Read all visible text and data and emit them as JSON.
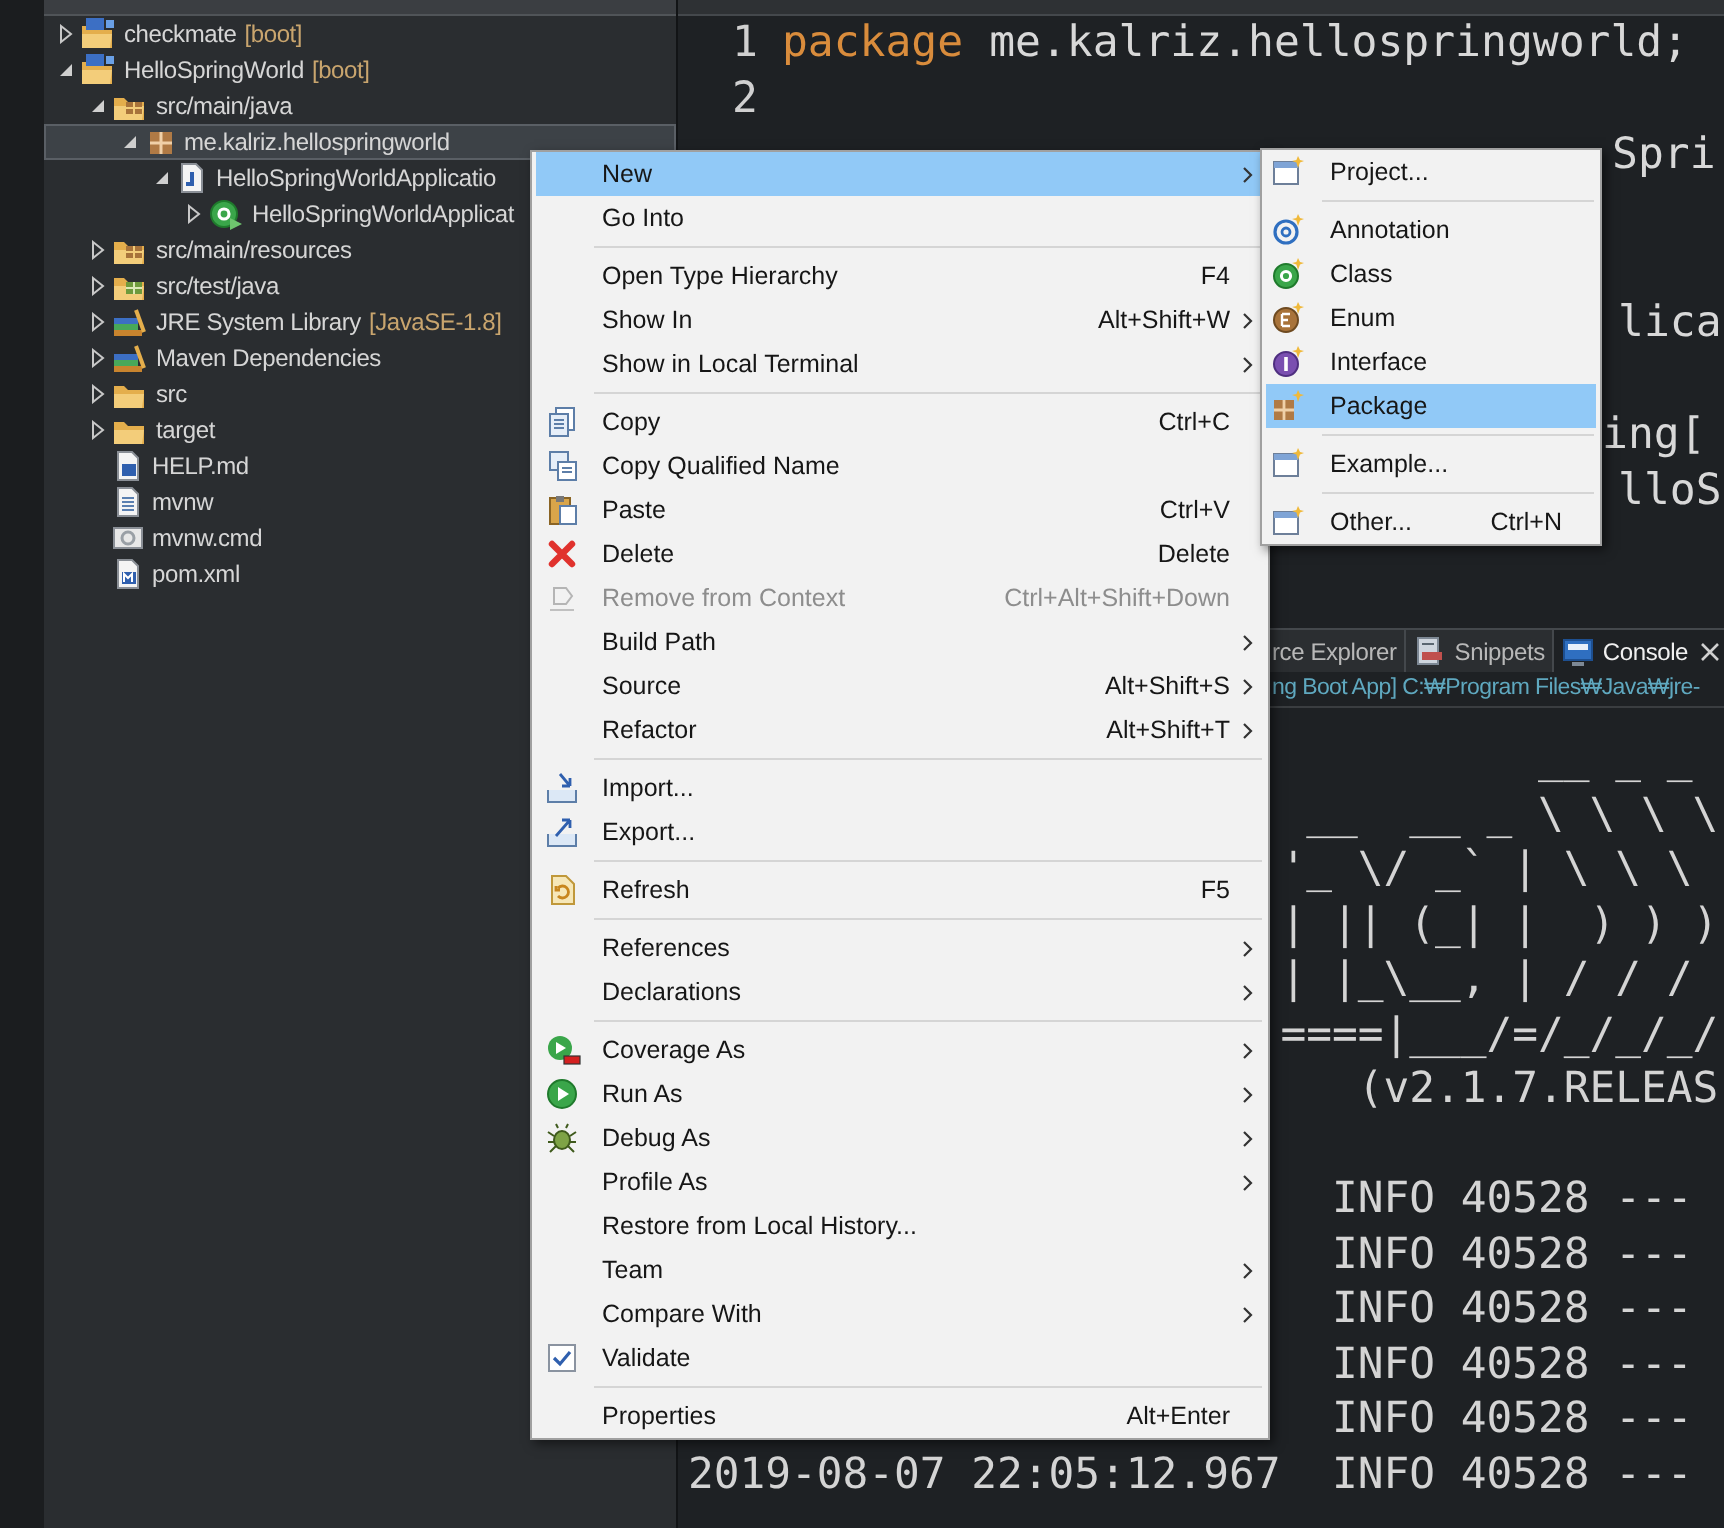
{
  "explorer": {
    "tree": [
      {
        "kind": "project",
        "label": "checkmate",
        "tag": "[boot]",
        "expanded": false,
        "selected": false
      },
      {
        "kind": "project",
        "label": "HelloSpringWorld",
        "tag": "[boot]",
        "expanded": true,
        "selected": false,
        "children": [
          {
            "kind": "srcfolder",
            "label": "src/main/java",
            "expanded": true,
            "selected": false,
            "children": [
              {
                "kind": "package",
                "label": "me.kalriz.hellospringworld",
                "expanded": true,
                "selected": true,
                "children": [
                  {
                    "kind": "javafile",
                    "label": "HelloSpringWorldApplicatio",
                    "expanded": true,
                    "selected": false,
                    "children": [
                      {
                        "kind": "class",
                        "label": "HelloSpringWorldApplicat",
                        "expanded": false,
                        "selected": false
                      }
                    ]
                  }
                ]
              }
            ]
          },
          {
            "kind": "srcfolder",
            "label": "src/main/resources",
            "expanded": false,
            "selected": false
          },
          {
            "kind": "testfolder",
            "label": "src/test/java",
            "expanded": false,
            "selected": false
          },
          {
            "kind": "library",
            "label": "JRE System Library",
            "tag": "[JavaSE-1.8]",
            "expanded": false,
            "selected": false
          },
          {
            "kind": "library",
            "label": "Maven Dependencies",
            "expanded": false,
            "selected": false
          },
          {
            "kind": "folder",
            "label": "src",
            "expanded": false,
            "selected": false
          },
          {
            "kind": "folder",
            "label": "target",
            "expanded": false,
            "selected": false
          },
          {
            "kind": "mdfile",
            "label": "HELP.md",
            "selected": false
          },
          {
            "kind": "textfile",
            "label": "mvnw",
            "selected": false
          },
          {
            "kind": "cmdfile",
            "label": "mvnw.cmd",
            "selected": false
          },
          {
            "kind": "pomfile",
            "label": "pom.xml",
            "selected": false
          }
        ]
      }
    ]
  },
  "editor": {
    "lines": [
      {
        "number": "1",
        "keyword": "package",
        "text": "me.kalriz.hellospringworld;"
      },
      {
        "number": "2"
      }
    ],
    "fragments": [
      "Spri",
      "lica",
      "ing[",
      "lloS"
    ]
  },
  "console": {
    "tabs": [
      {
        "label": "rce Explorer",
        "selected": false
      },
      {
        "label": "Snippets",
        "selected": false
      },
      {
        "label": "Console",
        "selected": true
      }
    ],
    "description": "ng Boot App] C:₩Program Files₩Java₩jre-",
    "lines": [
      "__ _ _",
      "__  __ _ \\ \\ \\ \\",
      "'_ \\/ _` | \\ \\ \\",
      "| || (_| |  ) ) )",
      "| |_\\__, | / / /",
      "====|___/=/_/_/_/",
      "(v2.1.7.RELEAS",
      "INFO 40528 ---",
      "INFO 40528 ---",
      "INFO 40528 ---",
      "INFO 40528 ---",
      "INFO 40528 ---",
      "2019-08-07 22:05:12.967  INFO 40528 ---"
    ]
  },
  "context_menu": {
    "items": [
      {
        "kind": "item",
        "label": "New",
        "has_submenu": true,
        "selected": true,
        "disabled": false
      },
      {
        "kind": "item",
        "label": "Go Into",
        "has_submenu": false,
        "selected": false,
        "disabled": false
      },
      {
        "kind": "separator"
      },
      {
        "kind": "item",
        "label": "Open Type Hierarchy",
        "shortcut": "F4",
        "has_submenu": false,
        "selected": false,
        "disabled": false
      },
      {
        "kind": "item",
        "label": "Show In",
        "shortcut": "Alt+Shift+W",
        "has_submenu": true,
        "selected": false,
        "disabled": false
      },
      {
        "kind": "item",
        "label": "Show in Local Terminal",
        "has_submenu": true,
        "selected": false,
        "disabled": false
      },
      {
        "kind": "separator"
      },
      {
        "kind": "item",
        "label": "Copy",
        "shortcut": "Ctrl+C",
        "has_submenu": false,
        "selected": false,
        "disabled": false
      },
      {
        "kind": "item",
        "label": "Copy Qualified Name",
        "has_submenu": false,
        "selected": false,
        "disabled": false
      },
      {
        "kind": "item",
        "label": "Paste",
        "shortcut": "Ctrl+V",
        "has_submenu": false,
        "selected": false,
        "disabled": false
      },
      {
        "kind": "item",
        "label": "Delete",
        "shortcut": "Delete",
        "has_submenu": false,
        "selected": false,
        "disabled": false
      },
      {
        "kind": "item",
        "label": "Remove from Context",
        "shortcut": "Ctrl+Alt+Shift+Down",
        "has_submenu": false,
        "selected": false,
        "disabled": true
      },
      {
        "kind": "item",
        "label": "Build Path",
        "has_submenu": true,
        "selected": false,
        "disabled": false
      },
      {
        "kind": "item",
        "label": "Source",
        "shortcut": "Alt+Shift+S",
        "has_submenu": true,
        "selected": false,
        "disabled": false
      },
      {
        "kind": "item",
        "label": "Refactor",
        "shortcut": "Alt+Shift+T",
        "has_submenu": true,
        "selected": false,
        "disabled": false
      },
      {
        "kind": "separator"
      },
      {
        "kind": "item",
        "label": "Import...",
        "has_submenu": false,
        "selected": false,
        "disabled": false
      },
      {
        "kind": "item",
        "label": "Export...",
        "has_submenu": false,
        "selected": false,
        "disabled": false
      },
      {
        "kind": "separator"
      },
      {
        "kind": "item",
        "label": "Refresh",
        "shortcut": "F5",
        "has_submenu": false,
        "selected": false,
        "disabled": false
      },
      {
        "kind": "separator"
      },
      {
        "kind": "item",
        "label": "References",
        "has_submenu": true,
        "selected": false,
        "disabled": false
      },
      {
        "kind": "item",
        "label": "Declarations",
        "has_submenu": true,
        "selected": false,
        "disabled": false
      },
      {
        "kind": "separator"
      },
      {
        "kind": "item",
        "label": "Coverage As",
        "has_submenu": true,
        "selected": false,
        "disabled": false
      },
      {
        "kind": "item",
        "label": "Run As",
        "has_submenu": true,
        "selected": false,
        "disabled": false
      },
      {
        "kind": "item",
        "label": "Debug As",
        "has_submenu": true,
        "selected": false,
        "disabled": false
      },
      {
        "kind": "item",
        "label": "Profile As",
        "has_submenu": true,
        "selected": false,
        "disabled": false
      },
      {
        "kind": "item",
        "label": "Restore from Local History...",
        "has_submenu": false,
        "selected": false,
        "disabled": false
      },
      {
        "kind": "item",
        "label": "Team",
        "has_submenu": true,
        "selected": false,
        "disabled": false
      },
      {
        "kind": "item",
        "label": "Compare With",
        "has_submenu": true,
        "selected": false,
        "disabled": false
      },
      {
        "kind": "item",
        "label": "Validate",
        "has_submenu": false,
        "selected": false,
        "disabled": false
      },
      {
        "kind": "separator"
      },
      {
        "kind": "item",
        "label": "Properties",
        "shortcut": "Alt+Enter",
        "has_submenu": false,
        "selected": false,
        "disabled": false
      }
    ]
  },
  "submenu": {
    "items": [
      {
        "kind": "item",
        "label": "Project...",
        "selected": false
      },
      {
        "kind": "separator"
      },
      {
        "kind": "item",
        "label": "Annotation",
        "selected": false
      },
      {
        "kind": "item",
        "label": "Class",
        "selected": false
      },
      {
        "kind": "item",
        "label": "Enum",
        "selected": false
      },
      {
        "kind": "item",
        "label": "Interface",
        "selected": false
      },
      {
        "kind": "item",
        "label": "Package",
        "selected": true
      },
      {
        "kind": "separator"
      },
      {
        "kind": "item",
        "label": "Example...",
        "selected": false
      },
      {
        "kind": "separator"
      },
      {
        "kind": "item",
        "label": "Other...",
        "shortcut": "Ctrl+N",
        "selected": false
      }
    ]
  }
}
